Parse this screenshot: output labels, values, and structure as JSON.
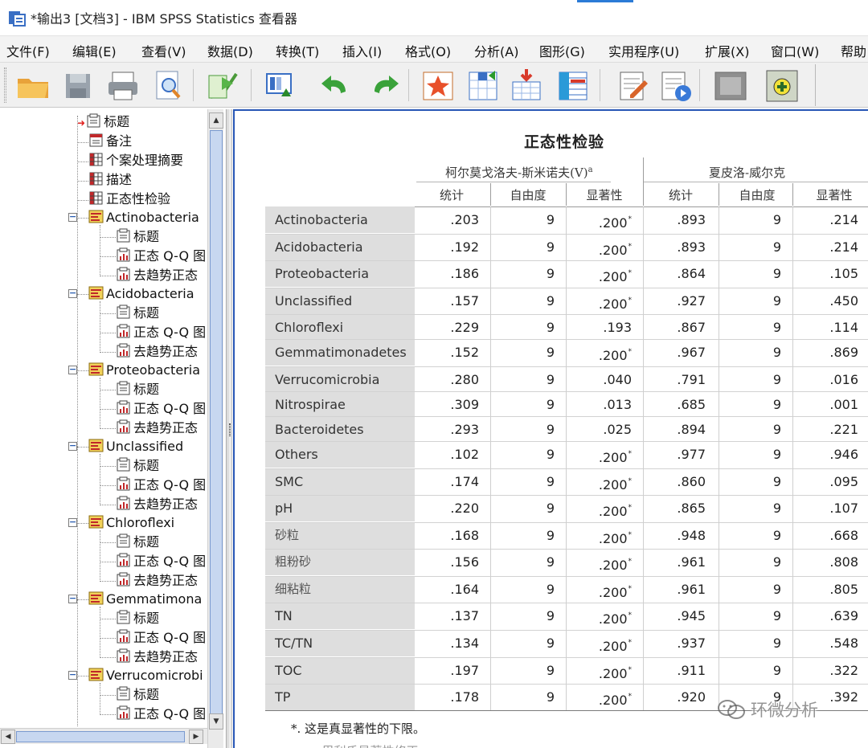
{
  "window": {
    "title": "*输出3 [文档3] - IBM SPSS Statistics 查看器"
  },
  "menu": [
    "文件(F)",
    "编辑(E)",
    "查看(V)",
    "数据(D)",
    "转换(T)",
    "插入(I)",
    "格式(O)",
    "分析(A)",
    "图形(G)",
    "实用程序(U)",
    "扩展(X)",
    "窗口(W)",
    "帮助"
  ],
  "toolbar": {
    "buttons": [
      "open-folder-icon",
      "save-icon",
      "print-icon",
      "print-preview-icon",
      "export-icon",
      "recall-dialog-icon",
      "undo-icon",
      "redo-icon",
      "goto-case-icon",
      "goto-variable-icon",
      "insert-cases-icon",
      "insert-variable-icon",
      "designate-window-icon",
      "run-script-icon",
      "show-all-icon",
      "create-annotation-icon"
    ]
  },
  "outline": {
    "top_items": [
      {
        "label": "标题",
        "icon": "title-icon"
      },
      {
        "label": "备注",
        "icon": "notes-icon"
      },
      {
        "label": "个案处理摘要",
        "icon": "table-icon"
      },
      {
        "label": "描述",
        "icon": "table-icon"
      },
      {
        "label": "正态性检验",
        "icon": "table-icon"
      }
    ],
    "groups": [
      {
        "label": "Actinobacteria",
        "children": [
          "标题",
          "正态 Q-Q 图",
          "去趋势正态"
        ]
      },
      {
        "label": "Acidobacteria",
        "children": [
          "标题",
          "正态 Q-Q 图",
          "去趋势正态"
        ]
      },
      {
        "label": "Proteobacteria",
        "children": [
          "标题",
          "正态 Q-Q 图",
          "去趋势正态"
        ]
      },
      {
        "label": "Unclassified",
        "children": [
          "标题",
          "正态 Q-Q 图",
          "去趋势正态"
        ]
      },
      {
        "label": "Chloroflexi",
        "children": [
          "标题",
          "正态 Q-Q 图",
          "去趋势正态"
        ]
      },
      {
        "label": "Gemmatimona",
        "children": [
          "标题",
          "正态 Q-Q 图",
          "去趋势正态"
        ]
      },
      {
        "label": "Verrucomicrobi",
        "children": [
          "标题",
          "正态 Q-Q 图"
        ]
      }
    ]
  },
  "table": {
    "title": "正态性检验",
    "group1": "柯尔莫戈洛夫-斯米诺夫(V)",
    "group1_sup": "a",
    "group2": "夏皮洛-威尔克",
    "col_stat": "统计",
    "col_df": "自由度",
    "col_sig": "显著性",
    "rows": [
      {
        "label": "Actinobacteria",
        "cn": false,
        "ks_stat": ".203",
        "ks_df": "9",
        "ks_sig": ".200",
        "ks_star": "*",
        "sw_stat": ".893",
        "sw_df": "9",
        "sw_sig": ".214"
      },
      {
        "label": "Acidobacteria",
        "cn": false,
        "ks_stat": ".192",
        "ks_df": "9",
        "ks_sig": ".200",
        "ks_star": "*",
        "sw_stat": ".893",
        "sw_df": "9",
        "sw_sig": ".214"
      },
      {
        "label": "Proteobacteria",
        "cn": false,
        "ks_stat": ".186",
        "ks_df": "9",
        "ks_sig": ".200",
        "ks_star": "*",
        "sw_stat": ".864",
        "sw_df": "9",
        "sw_sig": ".105"
      },
      {
        "label": "Unclassified",
        "cn": false,
        "ks_stat": ".157",
        "ks_df": "9",
        "ks_sig": ".200",
        "ks_star": "*",
        "sw_stat": ".927",
        "sw_df": "9",
        "sw_sig": ".450"
      },
      {
        "label": "Chloroflexi",
        "cn": false,
        "ks_stat": ".229",
        "ks_df": "9",
        "ks_sig": ".193",
        "ks_star": "",
        "sw_stat": ".867",
        "sw_df": "9",
        "sw_sig": ".114"
      },
      {
        "label": "Gemmatimonadetes",
        "cn": false,
        "ks_stat": ".152",
        "ks_df": "9",
        "ks_sig": ".200",
        "ks_star": "*",
        "sw_stat": ".967",
        "sw_df": "9",
        "sw_sig": ".869"
      },
      {
        "label": "Verrucomicrobia",
        "cn": false,
        "ks_stat": ".280",
        "ks_df": "9",
        "ks_sig": ".040",
        "ks_star": "",
        "sw_stat": ".791",
        "sw_df": "9",
        "sw_sig": ".016"
      },
      {
        "label": "Nitrospirae",
        "cn": false,
        "ks_stat": ".309",
        "ks_df": "9",
        "ks_sig": ".013",
        "ks_star": "",
        "sw_stat": ".685",
        "sw_df": "9",
        "sw_sig": ".001"
      },
      {
        "label": "Bacteroidetes",
        "cn": false,
        "ks_stat": ".293",
        "ks_df": "9",
        "ks_sig": ".025",
        "ks_star": "",
        "sw_stat": ".894",
        "sw_df": "9",
        "sw_sig": ".221"
      },
      {
        "label": "Others",
        "cn": false,
        "ks_stat": ".102",
        "ks_df": "9",
        "ks_sig": ".200",
        "ks_star": "*",
        "sw_stat": ".977",
        "sw_df": "9",
        "sw_sig": ".946"
      },
      {
        "label": "SMC",
        "cn": false,
        "ks_stat": ".174",
        "ks_df": "9",
        "ks_sig": ".200",
        "ks_star": "*",
        "sw_stat": ".860",
        "sw_df": "9",
        "sw_sig": ".095"
      },
      {
        "label": "pH",
        "cn": false,
        "ks_stat": ".220",
        "ks_df": "9",
        "ks_sig": ".200",
        "ks_star": "*",
        "sw_stat": ".865",
        "sw_df": "9",
        "sw_sig": ".107"
      },
      {
        "label": "砂粒",
        "cn": true,
        "ks_stat": ".168",
        "ks_df": "9",
        "ks_sig": ".200",
        "ks_star": "*",
        "sw_stat": ".948",
        "sw_df": "9",
        "sw_sig": ".668"
      },
      {
        "label": "粗粉砂",
        "cn": true,
        "ks_stat": ".156",
        "ks_df": "9",
        "ks_sig": ".200",
        "ks_star": "*",
        "sw_stat": ".961",
        "sw_df": "9",
        "sw_sig": ".808"
      },
      {
        "label": "细粘粒",
        "cn": true,
        "ks_stat": ".164",
        "ks_df": "9",
        "ks_sig": ".200",
        "ks_star": "*",
        "sw_stat": ".961",
        "sw_df": "9",
        "sw_sig": ".805"
      },
      {
        "label": "TN",
        "cn": false,
        "ks_stat": ".137",
        "ks_df": "9",
        "ks_sig": ".200",
        "ks_star": "*",
        "sw_stat": ".945",
        "sw_df": "9",
        "sw_sig": ".639"
      },
      {
        "label": "TC/TN",
        "cn": false,
        "ks_stat": ".134",
        "ks_df": "9",
        "ks_sig": ".200",
        "ks_star": "*",
        "sw_stat": ".937",
        "sw_df": "9",
        "sw_sig": ".548"
      },
      {
        "label": "TOC",
        "cn": false,
        "ks_stat": ".197",
        "ks_df": "9",
        "ks_sig": ".200",
        "ks_star": "*",
        "sw_stat": ".911",
        "sw_df": "9",
        "sw_sig": ".322"
      },
      {
        "label": "TP",
        "cn": false,
        "ks_stat": ".178",
        "ks_df": "9",
        "ks_sig": ".200",
        "ks_star": "*",
        "sw_stat": ".920",
        "sw_df": "9",
        "sw_sig": ".392"
      }
    ],
    "footnote": "*. 这是真显著性的下限。"
  },
  "watermark": "环微分析"
}
